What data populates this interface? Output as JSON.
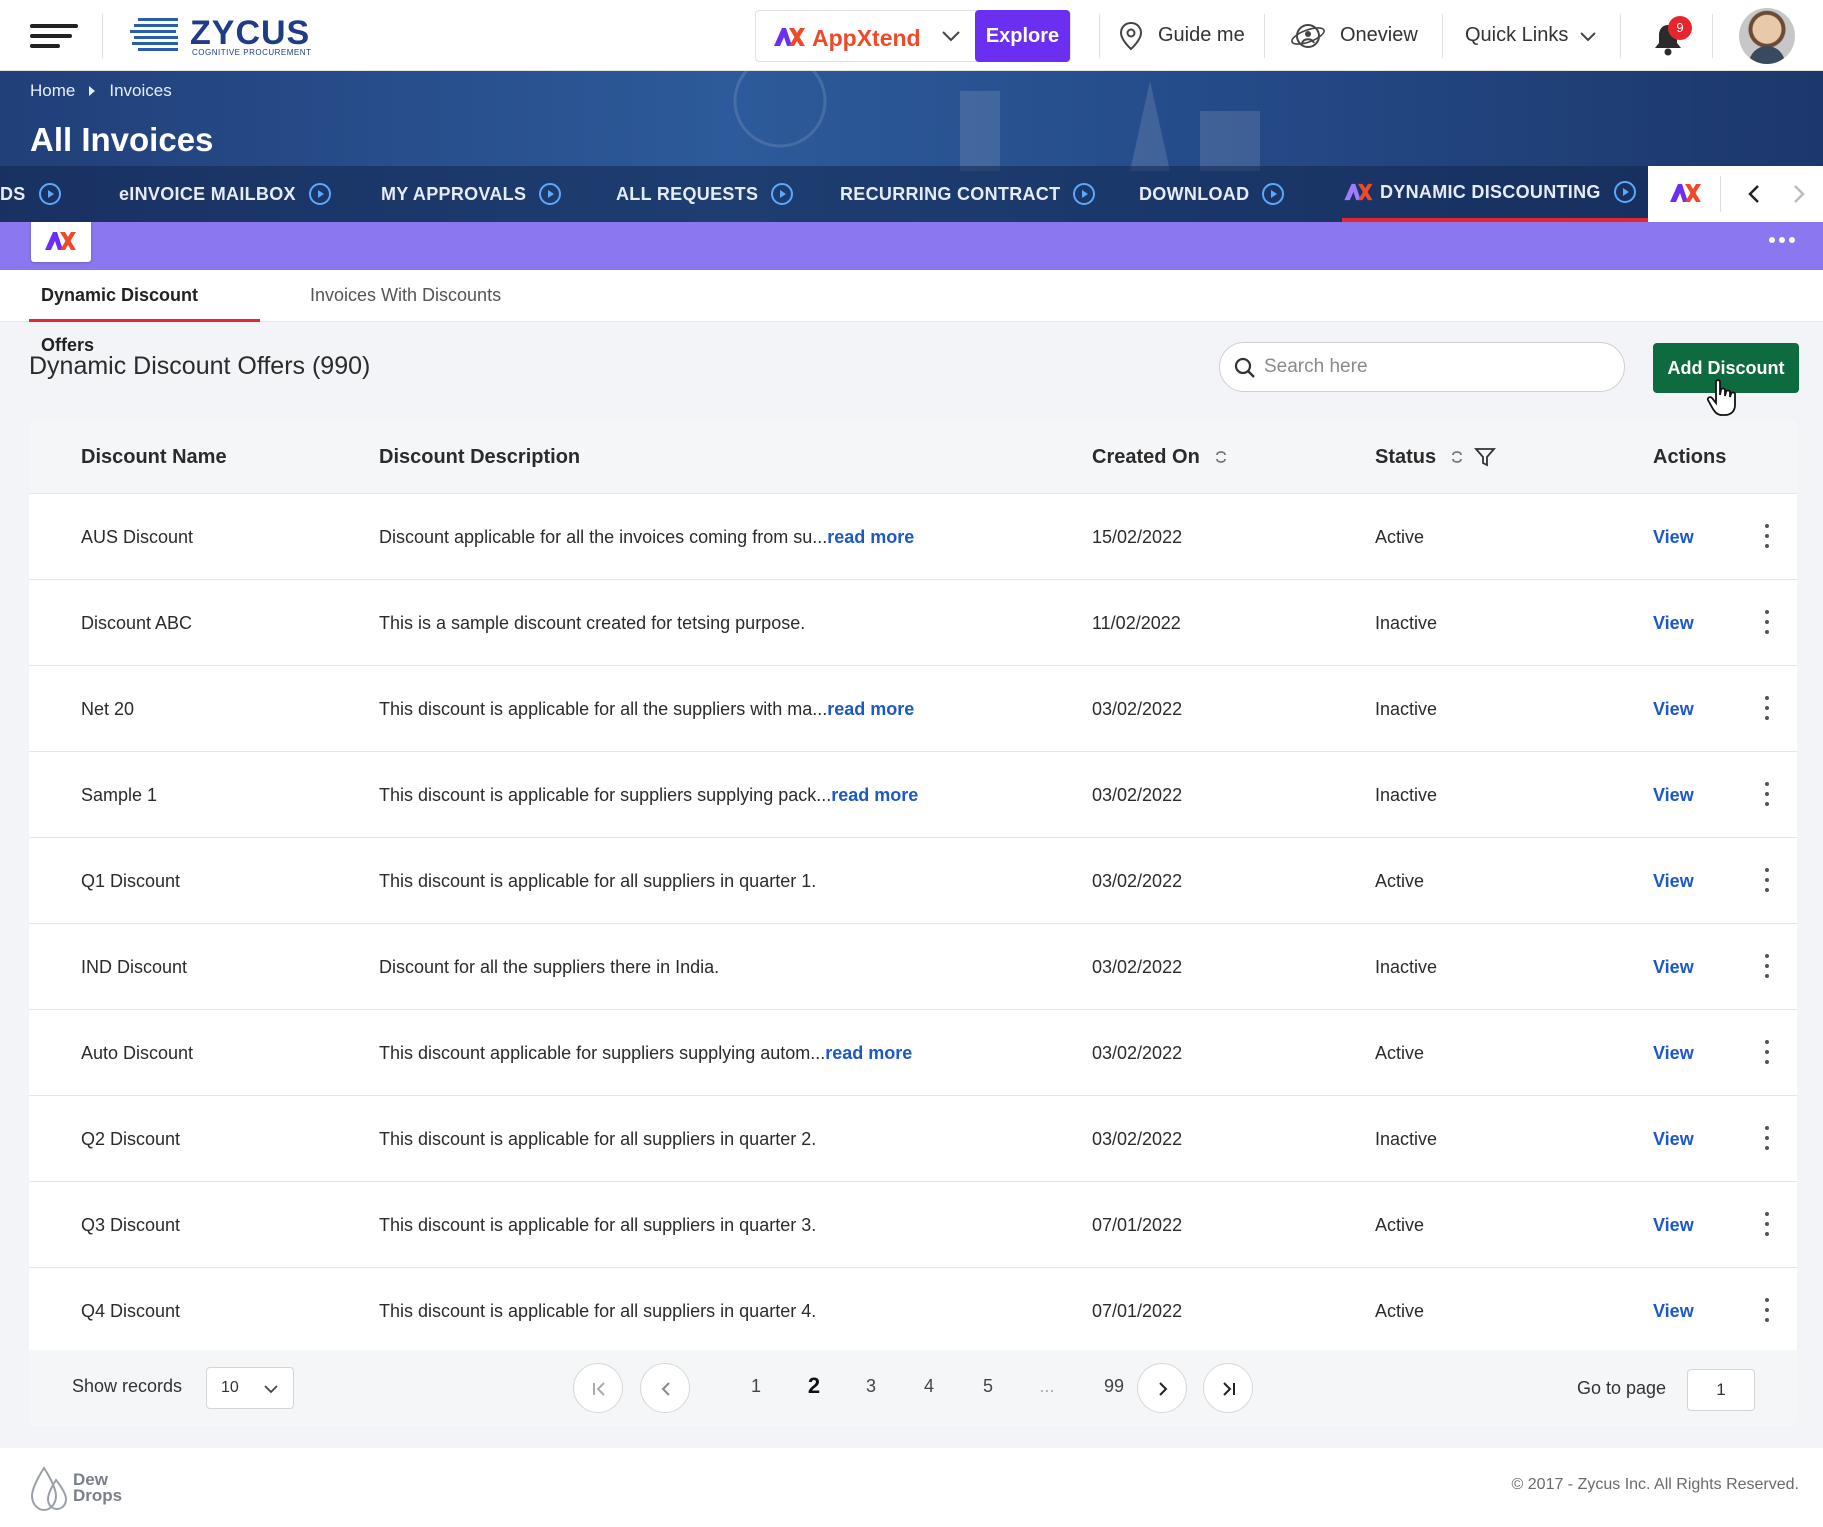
{
  "topbar": {
    "logo_text": "ZYCUS",
    "logo_sub": "COGNITIVE PROCUREMENT",
    "appxtend_label": "AppXtend",
    "explore_label": "Explore",
    "guide_label": "Guide me",
    "oneview_label": "Oneview",
    "quicklinks_label": "Quick Links",
    "notification_count": "9"
  },
  "breadcrumb": [
    "Home",
    "Invoices"
  ],
  "page_title": "All Invoices",
  "module_tabs": [
    {
      "label": "DS"
    },
    {
      "label": "eINVOICE MAILBOX"
    },
    {
      "label": "MY APPROVALS"
    },
    {
      "label": "ALL REQUESTS"
    },
    {
      "label": "RECURRING CONTRACT"
    },
    {
      "label": "DOWNLOAD"
    },
    {
      "label": "DYNAMIC DISCOUNTING",
      "active": true
    }
  ],
  "sub_tabs": [
    {
      "label": "Dynamic Discount Offers",
      "active": true
    },
    {
      "label": "Invoices With Discounts"
    }
  ],
  "list": {
    "title": "Dynamic Discount Offers (990)",
    "search_placeholder": "Search here",
    "add_label": "Add Discount"
  },
  "table": {
    "headers": {
      "name": "Discount Name",
      "description": "Discount Description",
      "created": "Created On",
      "status": "Status",
      "actions": "Actions"
    },
    "view_label": "View",
    "read_more_label": "read more",
    "rows": [
      {
        "name": "AUS Discount",
        "description": "Discount applicable for all the invoices coming from su...",
        "read_more": true,
        "created": "15/02/2022",
        "status": "Active"
      },
      {
        "name": "Discount ABC",
        "description": "This is a sample discount created for tetsing purpose.",
        "read_more": false,
        "created": "11/02/2022",
        "status": "Inactive"
      },
      {
        "name": "Net 20",
        "description": "This discount is applicable for all the suppliers with ma...",
        "read_more": true,
        "created": "03/02/2022",
        "status": "Inactive"
      },
      {
        "name": "Sample 1",
        "description": "This discount is applicable for suppliers supplying pack...",
        "read_more": true,
        "created": "03/02/2022",
        "status": "Inactive"
      },
      {
        "name": "Q1 Discount",
        "description": "This discount is applicable for all suppliers in quarter 1.",
        "read_more": false,
        "created": "03/02/2022",
        "status": "Active"
      },
      {
        "name": "IND Discount",
        "description": "Discount for all the suppliers there in India.",
        "read_more": false,
        "created": "03/02/2022",
        "status": "Inactive"
      },
      {
        "name": "Auto Discount",
        "description": "This discount applicable for suppliers supplying autom...",
        "read_more": true,
        "created": "03/02/2022",
        "status": "Active"
      },
      {
        "name": "Q2 Discount",
        "description": "This discount is applicable for all suppliers in quarter 2.",
        "read_more": false,
        "created": "03/02/2022",
        "status": "Inactive"
      },
      {
        "name": "Q3 Discount",
        "description": "This discount is applicable for all suppliers in quarter 3.",
        "read_more": false,
        "created": "07/01/2022",
        "status": "Active"
      },
      {
        "name": "Q4 Discount",
        "description": "This discount is applicable for all suppliers in quarter 4.",
        "read_more": false,
        "created": "07/01/2022",
        "status": "Active"
      }
    ]
  },
  "pagination": {
    "show_records_label": "Show records",
    "page_size": "10",
    "pages": [
      "1",
      "2",
      "3",
      "4",
      "5",
      "...",
      "99"
    ],
    "current_page": "2",
    "goto_label": "Go to page",
    "goto_value": "1"
  },
  "footer": {
    "brand": [
      "Dew",
      "Drops"
    ],
    "copyright": "© 2017 - Zycus Inc. All Rights Reserved."
  },
  "colors": {
    "accent_purple": "#6a2ff0",
    "primary_green": "#0e6a3f",
    "link_blue": "#1d58c8",
    "active_red": "#e5262e",
    "strip_purple": "#8b78f0"
  }
}
